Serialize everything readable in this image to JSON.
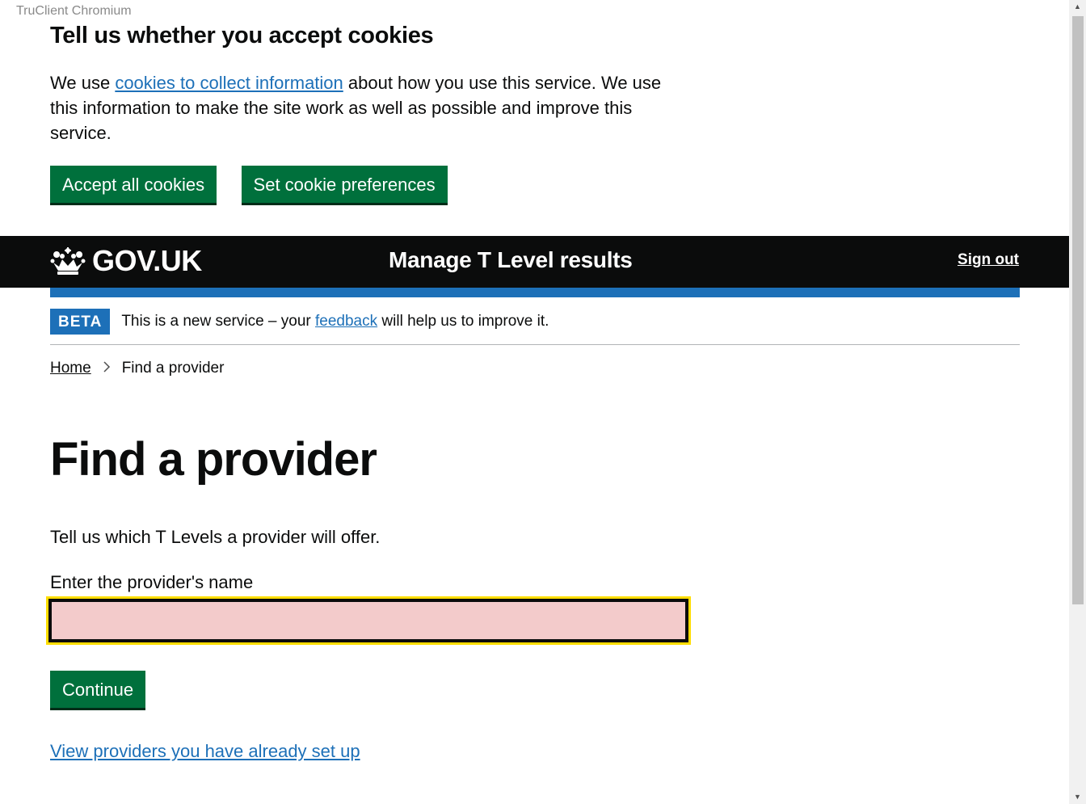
{
  "browser": {
    "label": "TruClient Chromium"
  },
  "cookie_banner": {
    "title": "Tell us whether you accept cookies",
    "text_before": "We use ",
    "link": "cookies to collect information",
    "text_after": " about how you use this service. We use this information to make the site work as well as possible and improve this service.",
    "accept_label": "Accept all cookies",
    "preferences_label": "Set cookie preferences"
  },
  "header": {
    "logo": "GOV.UK",
    "service_name": "Manage T Level results",
    "signout": "Sign out"
  },
  "phase_banner": {
    "tag": "BETA",
    "text_before": "This is a new service – your ",
    "link": "feedback",
    "text_after": " will help us to improve it."
  },
  "breadcrumb": {
    "home": "Home",
    "current": "Find a provider"
  },
  "main": {
    "title": "Find a provider",
    "lead": "Tell us which T Levels a provider will offer.",
    "input_label": "Enter the provider's name",
    "input_value": "",
    "continue_label": "Continue",
    "view_link": "View providers you have already set up"
  },
  "colors": {
    "primary_button": "#00703c",
    "link": "#1d70b8",
    "header_bg": "#0b0c0c",
    "focus": "#ffdd00",
    "input_bg": "#f3cbcb"
  },
  "icons": [
    "crown-icon",
    "chevron-right-icon"
  ]
}
